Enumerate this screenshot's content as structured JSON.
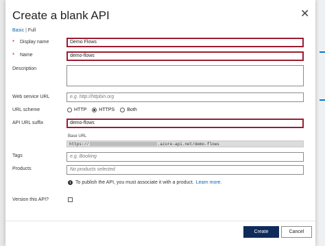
{
  "dialog": {
    "title": "Create a blank API",
    "close_glyph": "✕",
    "view_links": {
      "basic": "Basic",
      "separator": "|",
      "full": "Full"
    }
  },
  "form": {
    "required_marker": "*",
    "display_name": {
      "label": "Display name",
      "value": "Demo Flows"
    },
    "name": {
      "label": "Name",
      "value": "demo-flows"
    },
    "description": {
      "label": "Description",
      "value": ""
    },
    "web_service_url": {
      "label": "Web service URL",
      "placeholder": "e.g. http://httpbin.org"
    },
    "url_scheme": {
      "label": "URL scheme",
      "options": [
        "HTTP",
        "HTTPS",
        "Both"
      ],
      "selected": "HTTPS"
    },
    "api_url_suffix": {
      "label": "API URL suffix",
      "value": "demo-flows"
    },
    "base_url": {
      "label": "Base URL",
      "prefix": "https://",
      "suffix": ".azure-api.net/demo-flows"
    },
    "tags": {
      "label": "Tags",
      "placeholder": "e.g. Booking"
    },
    "products": {
      "label": "Products",
      "placeholder": "No products selected"
    },
    "info": {
      "icon": "info-icon",
      "text": "To publish the API, you must associate it with a product.",
      "link": "Learn more."
    },
    "version_api": {
      "label": "Version this API?",
      "checked": false
    }
  },
  "footer": {
    "create_label": "Create",
    "cancel_label": "Cancel"
  },
  "colors": {
    "accent": "#0067b8",
    "primary_button": "#0f2b5b",
    "highlight_border": "#9b1b30",
    "required": "#c4262e"
  }
}
